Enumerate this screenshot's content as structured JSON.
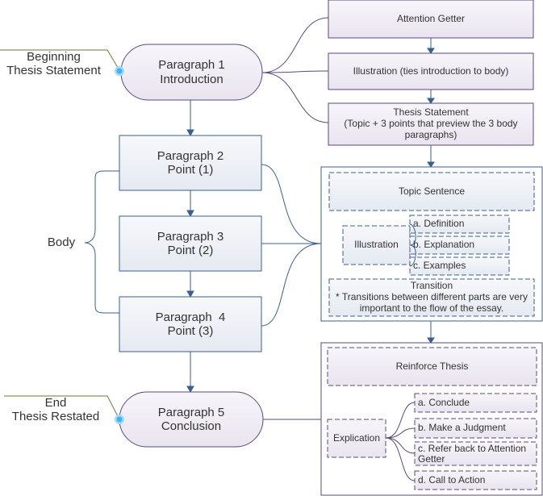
{
  "intro": {
    "label": "Beginning\nThesis Statement",
    "node_title": "Paragraph 1",
    "node_sub": "Introduction",
    "items": [
      "Attention Getter",
      "Illustration (ties introduction to body)",
      "Thesis Statement\n(Topic + 3 points that preview the 3 body paragraphs)"
    ]
  },
  "body": {
    "label": "Body",
    "paragraphs": [
      {
        "title": "Paragraph 2",
        "sub": "Point (1)"
      },
      {
        "title": "Paragraph 3",
        "sub": "Point (2)"
      },
      {
        "title": "Paragraph  4",
        "sub": "Point (3)"
      }
    ],
    "topic": "Topic Sentence",
    "illustration": "Illustration",
    "sub_items": [
      "a. Definition",
      "b. Explanation",
      "c. Examples"
    ],
    "transition": "Transition\n* Transitions between different parts are very important to the flow of the essay."
  },
  "conclusion": {
    "label": "End\nThesis Restated",
    "node_title": "Paragraph 5",
    "node_sub": "Conclusion",
    "reinforce": "Reinforce Thesis",
    "explication": "Explication",
    "sub_items": [
      "a. Conclude",
      "b. Make a Judgment",
      "c. Refer back to Attention Getter",
      "d. Call to Action"
    ]
  },
  "colors": {
    "blue": "#3b5f8f",
    "purple": "#5a4a7a",
    "green": "#6b7a3a",
    "dot": "#3fb4f0"
  }
}
